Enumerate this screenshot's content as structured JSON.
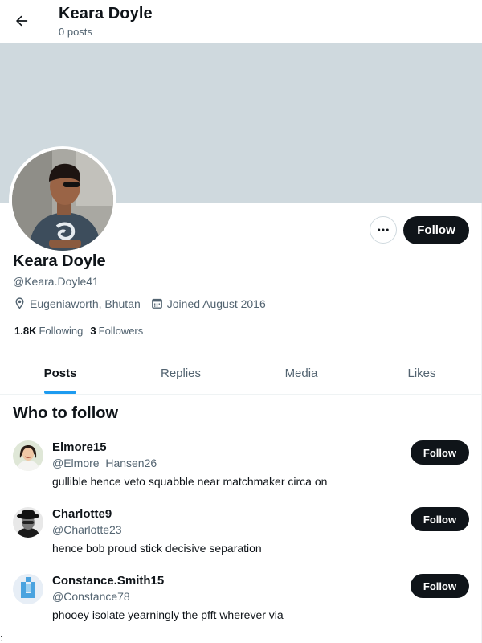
{
  "header": {
    "name": "Keara Doyle",
    "posts": "0 posts",
    "back_icon": "arrow-left-icon"
  },
  "profile": {
    "name": "Keara Doyle",
    "handle": "@Keara.Doyle41",
    "location": "Eugeniaworth, Bhutan",
    "joined": "Joined August 2016",
    "following_count": "1.8K",
    "following_label": "Following",
    "followers_count": "3",
    "followers_label": "Followers",
    "follow_label": "Follow",
    "more_icon": "more-horizontal-icon"
  },
  "tabs": [
    {
      "label": "Posts",
      "active": true
    },
    {
      "label": "Replies",
      "active": false
    },
    {
      "label": "Media",
      "active": false
    },
    {
      "label": "Likes",
      "active": false
    }
  ],
  "who_to_follow": {
    "title": "Who to follow",
    "people": [
      {
        "name": "Elmore15",
        "handle": "@Elmore_Hansen26",
        "bio": "gullible hence veto squabble near matchmaker circa on",
        "follow": "Follow"
      },
      {
        "name": "Charlotte9",
        "handle": "@Charlotte23",
        "bio": "hence bob proud stick decisive separation",
        "follow": "Follow"
      },
      {
        "name": "Constance.Smith15",
        "handle": "@Constance78",
        "bio": "phooey isolate yearningly the pfft wherever via",
        "follow": "Follow"
      }
    ]
  },
  "footer": {
    "edge_text": ":"
  },
  "colors": {
    "banner": "#cfd9de",
    "accent": "#1d9bf0",
    "button": "#0f1419",
    "muted": "#536471"
  }
}
